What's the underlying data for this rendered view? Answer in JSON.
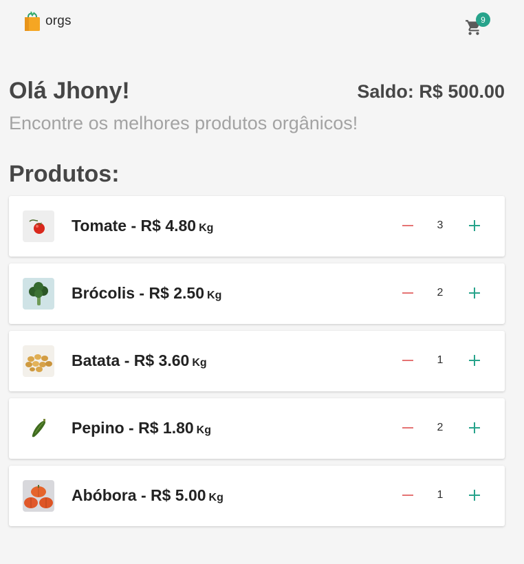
{
  "app": {
    "logo_text": "orgs",
    "cart_count": "9",
    "accent_color": "#27a38b",
    "minus_color": "#e57373"
  },
  "header": {
    "greeting": "Olá Jhony!",
    "balance": "Saldo: R$ 500.00",
    "subtitle": "Encontre os melhores produtos orgânicos!"
  },
  "products_section": {
    "title": "Produtos:",
    "items": [
      {
        "name": "Tomate",
        "title": "Tomate - R$ 4.80",
        "unit": "Kg",
        "quantity": "3",
        "icon": "tomato-image"
      },
      {
        "name": "Brócolis",
        "title": "Brócolis - R$ 2.50",
        "unit": "Kg",
        "quantity": "2",
        "icon": "broccoli-image"
      },
      {
        "name": "Batata",
        "title": "Batata - R$ 3.60",
        "unit": "Kg",
        "quantity": "1",
        "icon": "potato-image"
      },
      {
        "name": "Pepino",
        "title": "Pepino - R$ 1.80",
        "unit": "Kg",
        "quantity": "2",
        "icon": "cucumber-image"
      },
      {
        "name": "Abóbora",
        "title": "Abóbora - R$ 5.00",
        "unit": "Kg",
        "quantity": "1",
        "icon": "pumpkin-image"
      }
    ]
  }
}
